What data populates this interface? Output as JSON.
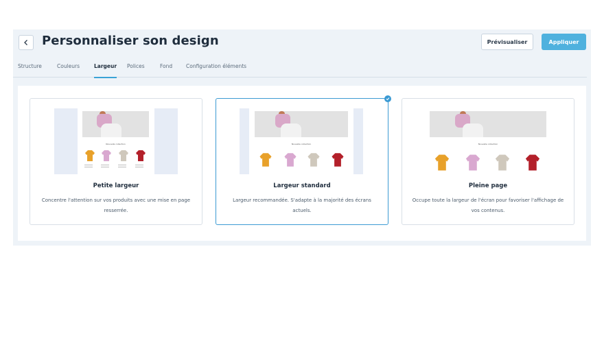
{
  "header": {
    "title": "Personnaliser son design",
    "preview_label": "Prévisualiser",
    "apply_label": "Appliquer"
  },
  "tabs": [
    {
      "label": "Structure"
    },
    {
      "label": "Couleurs"
    },
    {
      "label": "Largeur",
      "active": true
    },
    {
      "label": "Polices"
    },
    {
      "label": "Fond"
    },
    {
      "label": "Configuration éléments"
    }
  ],
  "cards": [
    {
      "title": "Petite largeur",
      "description": "Concentre l'attention sur vos produits avec une mise en page resserrée.",
      "selected": false
    },
    {
      "title": "Largeur standard",
      "description": "Largeur recommandée. S'adapte à la majorité des écrans actuels.",
      "selected": true
    },
    {
      "title": "Pleine page",
      "description": "Occupe toute la largeur de l'écran pour favoriser l'affichage de vos contenus.",
      "selected": false
    }
  ],
  "preview": {
    "section_title": "Nouvelle collection",
    "sweater_colors": [
      "#e8a12a",
      "#d9a8d0",
      "#cfc8bc",
      "#b3202a"
    ]
  },
  "colors": {
    "accent": "#3b9ad3",
    "apply_button": "#4fb1de",
    "panel_bg": "#eef3f8"
  }
}
